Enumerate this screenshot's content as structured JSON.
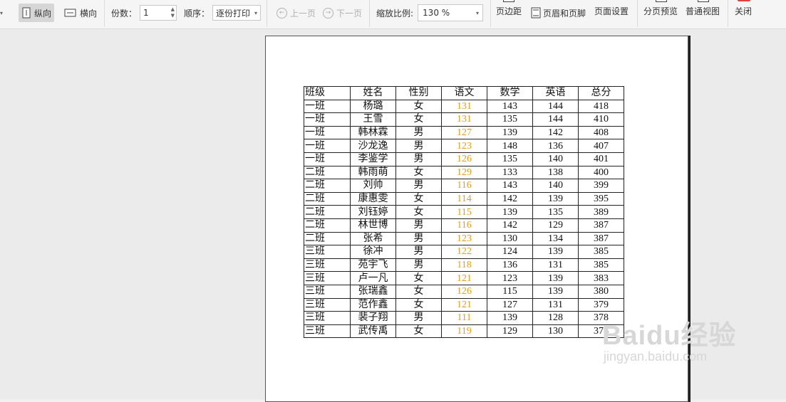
{
  "toolbar": {
    "portrait": "纵向",
    "landscape": "横向",
    "copies_label": "份数：",
    "copies_value": "1",
    "order_label": "顺序：",
    "order_value": "逐份打印",
    "prev_page": "上一页",
    "next_page": "下一页",
    "zoom_label": "缩放比例:",
    "zoom_value": "130 %",
    "margins": "页边距",
    "header_footer": "页眉和页脚",
    "page_setup": "页面设置",
    "page_break_preview": "分页预览",
    "normal_view": "普通视图",
    "close": "关闭"
  },
  "sheet": {
    "headers": [
      "班级",
      "姓名",
      "性别",
      "语文",
      "数学",
      "英语",
      "总分"
    ],
    "rows": [
      [
        "一班",
        "杨璐",
        "女",
        "131",
        "143",
        "144",
        "418"
      ],
      [
        "一班",
        "王雪",
        "女",
        "131",
        "135",
        "144",
        "410"
      ],
      [
        "一班",
        "韩林霖",
        "男",
        "127",
        "139",
        "142",
        "408"
      ],
      [
        "一班",
        "沙龙逸",
        "男",
        "123",
        "148",
        "136",
        "407"
      ],
      [
        "一班",
        "李鉴学",
        "男",
        "126",
        "135",
        "140",
        "401"
      ],
      [
        "二班",
        "韩雨萌",
        "女",
        "129",
        "133",
        "138",
        "400"
      ],
      [
        "二班",
        "刘帅",
        "男",
        "116",
        "143",
        "140",
        "399"
      ],
      [
        "二班",
        "康惠雯",
        "女",
        "114",
        "142",
        "139",
        "395"
      ],
      [
        "二班",
        "刘钰婷",
        "女",
        "115",
        "139",
        "135",
        "389"
      ],
      [
        "二班",
        "林世博",
        "男",
        "116",
        "142",
        "129",
        "387"
      ],
      [
        "二班",
        "张希",
        "男",
        "123",
        "130",
        "134",
        "387"
      ],
      [
        "三班",
        "徐冲",
        "男",
        "122",
        "124",
        "139",
        "385"
      ],
      [
        "三班",
        "苑宇飞",
        "男",
        "118",
        "136",
        "131",
        "385"
      ],
      [
        "三班",
        "卢一凡",
        "女",
        "121",
        "123",
        "139",
        "383"
      ],
      [
        "三班",
        "张瑞鑫",
        "女",
        "126",
        "115",
        "139",
        "380"
      ],
      [
        "三班",
        "范作鑫",
        "女",
        "121",
        "127",
        "131",
        "379"
      ],
      [
        "三班",
        "裴子翔",
        "男",
        "111",
        "139",
        "128",
        "378"
      ],
      [
        "三班",
        "武传禹",
        "女",
        "119",
        "129",
        "130",
        "378"
      ]
    ],
    "highlight_color": "#e0a020"
  },
  "watermark": {
    "brand": "Baidu经验",
    "url": "jingyan.baidu.com"
  }
}
